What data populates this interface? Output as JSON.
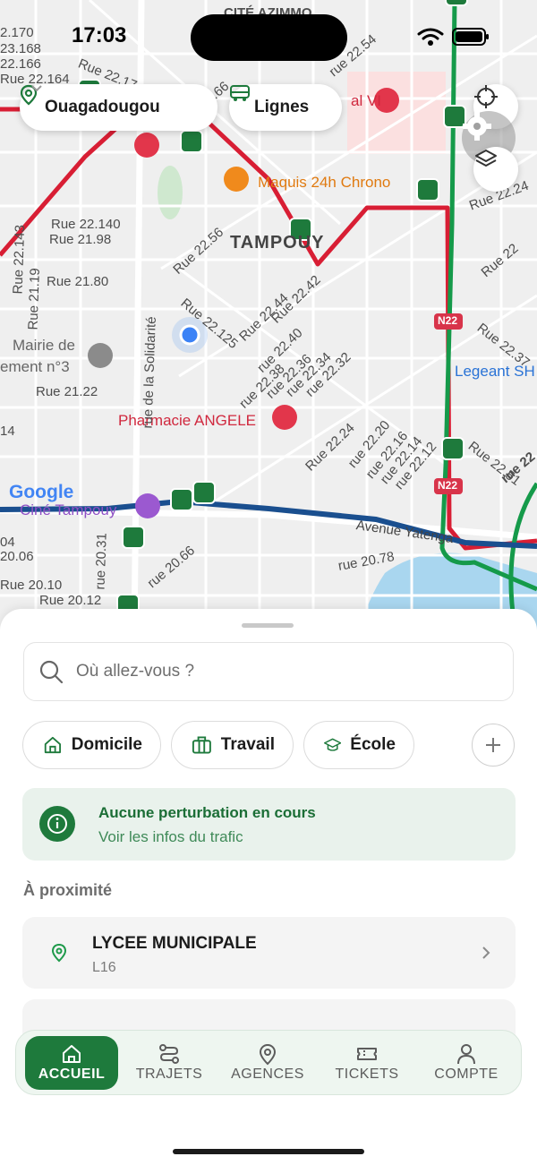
{
  "status_bar": {
    "time": "17:03"
  },
  "map": {
    "city_chip": "Ouagadougou",
    "lines_chip": "Lignes",
    "provider_logo": "Google",
    "labels": {
      "district_top": "CITÉ AZIMMO",
      "district": "TAMPOUY",
      "maquis": "Maquis 24h Chrono",
      "pharmacie": "Pharmacie ANGELE",
      "mairie_1": "Mairie de",
      "mairie_2": "ement n°3",
      "legeant": "Legeant SH",
      "cine": "Ciné Tampouy",
      "avenue": "Avenue Yatenga",
      "hospital": "al VI",
      "solidarite": "rue de la Solidarité",
      "road_badge_1": "N22",
      "road_badge_2": "N22",
      "r22170": "2.170",
      "r23168": "23.168",
      "r22166": "22.166",
      "r22164": "Rue 22.164",
      "rue2217": "Rue 22.17",
      "r2266": "22.66",
      "r2254": "rue 22.54",
      "r22140": "Rue 22.140",
      "r2198": "Rue 21.98",
      "r22143": "Rue 22.143",
      "r2119": "Rue 21.19",
      "r2180": "Rue 21.80",
      "r2256": "Rue 22.56",
      "r2224": "Rue 22.24",
      "r22125": "Rue 22.125",
      "r2244": "Rue 22.44",
      "r2242": "Rue 22.42",
      "r2240": "rue 22.40",
      "r2238": "rue 22.38",
      "r2236": "rue 22.36",
      "r2234": "rue 22.34",
      "r2232": "rue 22.32",
      "r2122": "Rue 21.22",
      "r2237": "Rue 22.37",
      "rue22": "Rue 22",
      "r2224b": "Rue 22.24",
      "r2220": "rue 22.20",
      "r2216": "rue 22.16",
      "r2214": "rue 22.14",
      "r2212": "rue 22.12",
      "r2251": "Rue 22.51",
      "rue22c": "rue 22",
      "r2078": "rue 20.78",
      "r2066": "rue 20.66",
      "r2031": "rue 20.31",
      "r2006": "20.06",
      "r2010": "Rue 20.10",
      "r2012": "Rue 20.12",
      "r2004": "04",
      "r14": "14"
    }
  },
  "sheet": {
    "search_placeholder": "Où allez-vous ?",
    "shortcuts": [
      "Domicile",
      "Travail",
      "École"
    ],
    "info_title": "Aucune perturbation en cours",
    "info_subtitle": "Voir les infos du trafic",
    "nearby_title": "À proximité",
    "nearby": [
      {
        "name": "LYCEE MUNICIPALE",
        "line": "L16"
      }
    ]
  },
  "tabs": [
    "ACCUEIL",
    "TRAJETS",
    "AGENCES",
    "TICKETS",
    "COMPTE"
  ],
  "colors": {
    "brand_green": "#1e7a3c",
    "line_red": "#d81e34",
    "line_blue": "#1a4f8f",
    "line_green": "#159a4a"
  }
}
